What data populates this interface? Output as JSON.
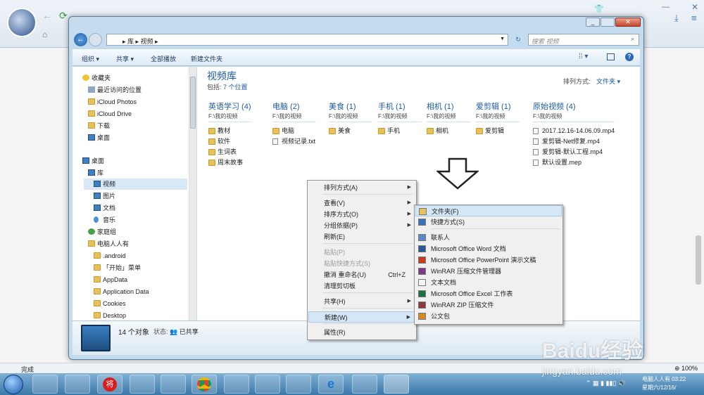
{
  "explorer": {
    "breadcrumb": [
      "库",
      "视频"
    ],
    "search_placeholder": "搜索 视频",
    "toolbar": [
      "组织",
      "共享",
      "全部播放",
      "新建文件夹"
    ],
    "library_title": "视频库",
    "library_includes": "包括:",
    "library_count": "7 个位置",
    "sort_label": "排列方式:",
    "sort_value": "文件夹"
  },
  "nav": [
    {
      "label": "收藏夹",
      "icon": "star-icon"
    },
    {
      "label": "最近访问的位置",
      "icon": "recent-icon"
    },
    {
      "label": "iCloud Photos",
      "icon": "folder-icon"
    },
    {
      "label": "iCloud Drive",
      "icon": "folder-icon"
    },
    {
      "label": "下载",
      "icon": "download-folder-icon"
    },
    {
      "label": "桌面",
      "icon": "desktop-icon"
    },
    {
      "label": "桌面",
      "icon": "desktop-icon"
    },
    {
      "label": "库",
      "icon": "library-icon"
    },
    {
      "label": "视频",
      "icon": "video-library-icon"
    },
    {
      "label": "图片",
      "icon": "picture-library-icon"
    },
    {
      "label": "文档",
      "icon": "document-library-icon"
    },
    {
      "label": "音乐",
      "icon": "music-icon"
    },
    {
      "label": "家庭组",
      "icon": "homegroup-icon"
    },
    {
      "label": "电脑人人有",
      "icon": "user-folder-icon"
    },
    {
      "label": ".android",
      "icon": "folder-icon"
    },
    {
      "label": "「开始」菜单",
      "icon": "folder-icon"
    },
    {
      "label": "AppData",
      "icon": "folder-icon"
    },
    {
      "label": "Application Data",
      "icon": "folder-icon"
    },
    {
      "label": "Cookies",
      "icon": "folder-icon"
    },
    {
      "label": "Desktop",
      "icon": "folder-icon"
    }
  ],
  "groups": [
    {
      "title": "英语学习 (4)",
      "path": "F:\\我的视频",
      "items": [
        "教材",
        "软件",
        "生词表",
        "周末故事"
      ]
    },
    {
      "title": "电脑 (2)",
      "path": "F:\\我的视频",
      "items": [
        "电脑",
        "视频记录.txt"
      ]
    },
    {
      "title": "美食 (1)",
      "path": "F:\\我的视频",
      "items": [
        "美食"
      ]
    },
    {
      "title": "手机 (1)",
      "path": "F:\\我的视频",
      "items": [
        "手机"
      ]
    },
    {
      "title": "相机 (1)",
      "path": "F:\\我的视频",
      "items": [
        "相机"
      ]
    },
    {
      "title": "爱剪辑 (1)",
      "path": "F:\\我的视频",
      "items": [
        "爱剪辑"
      ]
    },
    {
      "title": "原始视频 (4)",
      "path": "F:\\我的视频",
      "items": [
        "2017.12.16-14.06.09.mp4",
        "爱剪辑-Net修复.mp4",
        "爱剪辑-默认工程.mp4",
        "默认设置.mep"
      ]
    }
  ],
  "details": {
    "count": "14 个对象",
    "state_label": "状态:",
    "state_value": "已共享"
  },
  "context_menu": [
    {
      "label": "排列方式(A)",
      "sub": true
    },
    {
      "label": "查看(V)",
      "sub": true
    },
    {
      "label": "排序方式(O)",
      "sub": true
    },
    {
      "label": "分组依据(P)",
      "sub": true
    },
    {
      "label": "刷新(E)"
    },
    {
      "label": "粘贴(P)",
      "disabled": true
    },
    {
      "label": "粘贴快捷方式(S)",
      "disabled": true
    },
    {
      "label": "撤消 重命名(U)",
      "shortcut": "Ctrl+Z"
    },
    {
      "label": "清理剪切板"
    },
    {
      "label": "共享(H)",
      "sub": true
    },
    {
      "label": "新建(W)",
      "sub": true
    },
    {
      "label": "属性(R)"
    }
  ],
  "submenu": [
    "文件夹(F)",
    "快捷方式(S)",
    "联系人",
    "Microsoft Office Word 文档",
    "Microsoft Office PowerPoint 演示文稿",
    "WinRAR 压缩文件管理器",
    "文本文档",
    "Microsoft Office Excel 工作表",
    "WinRAR ZIP 压缩文件",
    "公文包"
  ],
  "browser": {
    "status": "完成"
  },
  "clock": {
    "line1": "电脑人人有 03:22",
    "line2": "星期六/12/16/"
  },
  "watermark": {
    "logo": "Baidu经验",
    "url": "jingyan.baidu.com"
  }
}
